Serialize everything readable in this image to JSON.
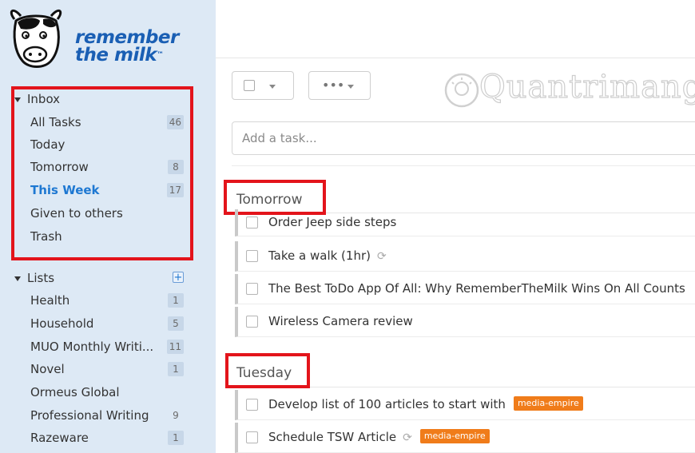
{
  "brand": {
    "line1": "remember",
    "line2": "the milk",
    "tm": "™"
  },
  "sidebar": {
    "inbox_header": "Inbox",
    "inbox_items": [
      {
        "label": "All Tasks",
        "count": "46"
      },
      {
        "label": "Today",
        "count": ""
      },
      {
        "label": "Tomorrow",
        "count": "8"
      },
      {
        "label": "This Week",
        "count": "17"
      },
      {
        "label": "Given to others",
        "count": ""
      },
      {
        "label": "Trash",
        "count": ""
      }
    ],
    "lists_header": "Lists",
    "lists_add": "+",
    "list_items": [
      {
        "label": "Health",
        "count": "1"
      },
      {
        "label": "Household",
        "count": "5"
      },
      {
        "label": "MUO Monthly Writi...",
        "count": "11"
      },
      {
        "label": "Novel",
        "count": "1"
      },
      {
        "label": "Ormeus Global",
        "count": ""
      },
      {
        "label": "Professional Writing",
        "count": "9"
      },
      {
        "label": "Razeware",
        "count": "1"
      }
    ]
  },
  "watermark": "Quantrimang",
  "add_task": {
    "placeholder": "Add a task..."
  },
  "groups": [
    {
      "title": "Tomorrow",
      "tasks": [
        {
          "text": "Order Jeep side steps",
          "recurring": false,
          "tag": ""
        },
        {
          "text": "Take a walk (1hr)",
          "recurring": true,
          "tag": ""
        },
        {
          "text": "The Best ToDo App Of All: Why RememberTheMilk Wins On All Counts",
          "recurring": false,
          "tag": ""
        },
        {
          "text": "Wireless Camera review",
          "recurring": false,
          "tag": ""
        }
      ]
    },
    {
      "title": "Tuesday",
      "tasks": [
        {
          "text": "Develop list of 100 articles to start with",
          "recurring": false,
          "tag": "media-empire"
        },
        {
          "text": "Schedule TSW Article",
          "recurring": true,
          "tag": "media-empire"
        }
      ]
    }
  ],
  "colors": {
    "highlight": "#e3141b",
    "tag": "#f07c1a",
    "active": "#1e78d2",
    "sidebar_bg": "#dde9f5"
  },
  "icons": {
    "recurring": "refresh-icon",
    "select": "checkbox-icon",
    "more": "more-dots-icon"
  }
}
